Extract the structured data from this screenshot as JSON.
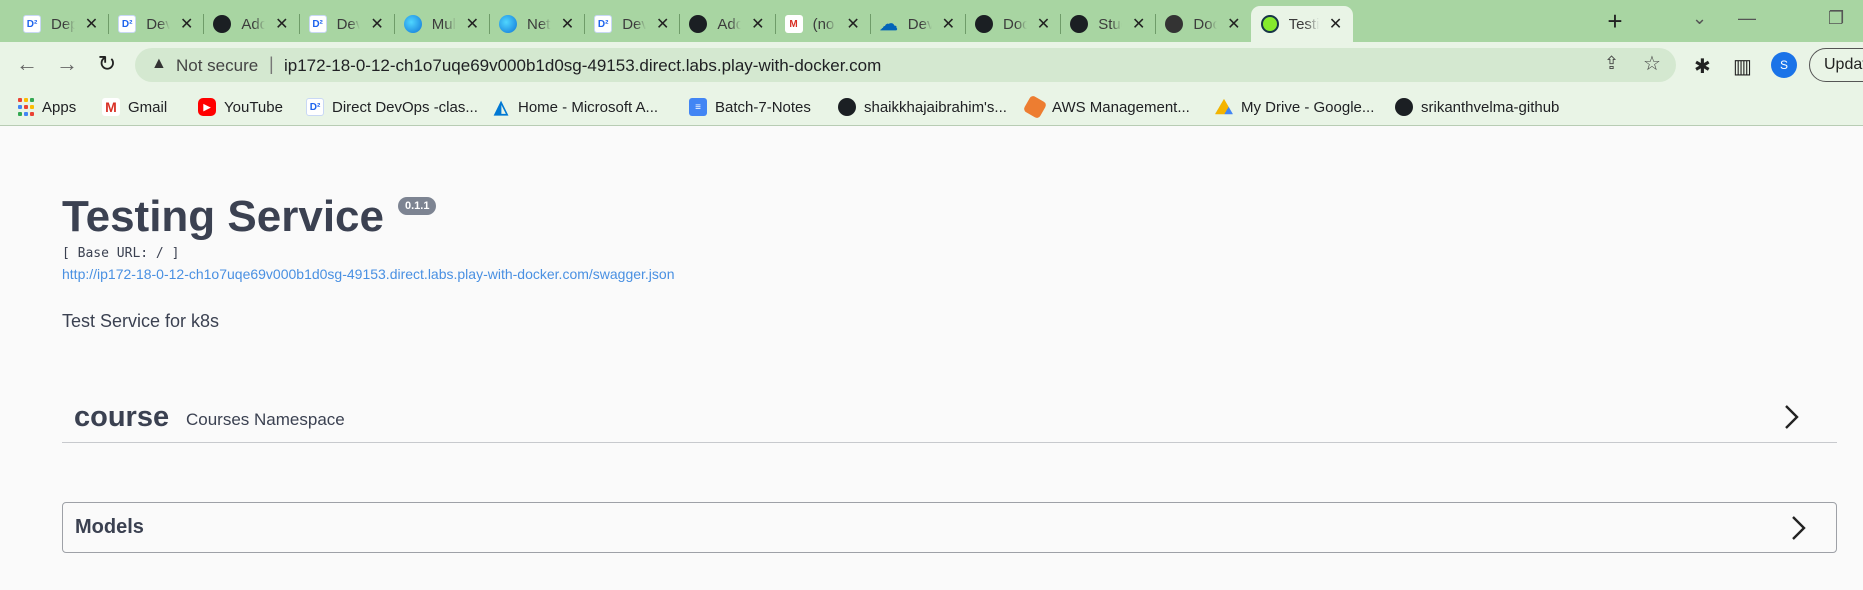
{
  "browser": {
    "tabs": [
      {
        "title": "Deploy",
        "icon": "docker-labs-icon",
        "favclass": "fav-docker",
        "glyph": "D²"
      },
      {
        "title": "DevOps",
        "icon": "docker-labs-icon",
        "favclass": "fav-docker",
        "glyph": "D²"
      },
      {
        "title": "Added",
        "icon": "github-icon",
        "favclass": "fav-gh",
        "glyph": ""
      },
      {
        "title": "DevOps",
        "icon": "docker-labs-icon",
        "favclass": "fav-docker",
        "glyph": "D²"
      },
      {
        "title": "Multi",
        "icon": "edge-icon",
        "favclass": "fav-edge",
        "glyph": ""
      },
      {
        "title": "Netw",
        "icon": "edge-icon",
        "favclass": "fav-edge",
        "glyph": ""
      },
      {
        "title": "DevOps",
        "icon": "docker-labs-icon",
        "favclass": "fav-docker",
        "glyph": "D²"
      },
      {
        "title": "Added",
        "icon": "github-icon",
        "favclass": "fav-gh",
        "glyph": ""
      },
      {
        "title": "(no s",
        "icon": "gmail-icon",
        "favclass": "fav-gmail",
        "glyph": "M"
      },
      {
        "title": "DevOps",
        "icon": "onedrive-icon",
        "favclass": "fav-onedrive",
        "glyph": "☁"
      },
      {
        "title": "Dock",
        "icon": "github-icon",
        "favclass": "fav-gh",
        "glyph": ""
      },
      {
        "title": "Stud",
        "icon": "github-icon",
        "favclass": "fav-gh",
        "glyph": ""
      },
      {
        "title": "Dock",
        "icon": "globe-icon",
        "favclass": "fav-globe",
        "glyph": ""
      },
      {
        "title": "Testi",
        "icon": "swagger-icon",
        "favclass": "fav-swagger",
        "glyph": "",
        "active": true
      }
    ],
    "new_tab_label": "+",
    "close_glyph": "✕",
    "omnibox": {
      "security_label": "Not secure",
      "separator": "|",
      "url": "ip172-18-0-12-ch1o7uqe69v000b1d0sg-49153.direct.labs.play-with-docker.com"
    },
    "profile_initial": "S",
    "update_label": "Update",
    "bookmarks": [
      {
        "label": "Apps",
        "icon": "apps-grid-icon",
        "iclass": "bmi-apps"
      },
      {
        "label": "Gmail",
        "icon": "gmail-icon",
        "iclass": "bmi-gmail"
      },
      {
        "label": "YouTube",
        "icon": "youtube-icon",
        "iclass": "bmi-yt"
      },
      {
        "label": "Direct DevOps -clas...",
        "icon": "docker-labs-icon",
        "iclass": "bmi-docker"
      },
      {
        "label": "Home - Microsoft A...",
        "icon": "azure-icon",
        "iclass": "bmi-azure"
      },
      {
        "label": "Batch-7-Notes",
        "icon": "google-docs-icon",
        "iclass": "bmi-docs"
      },
      {
        "label": "shaikkhajaibrahim's...",
        "icon": "github-icon",
        "iclass": "bmi-gh"
      },
      {
        "label": "AWS Management...",
        "icon": "aws-icon",
        "iclass": "bmi-aws"
      },
      {
        "label": "My Drive - Google...",
        "icon": "google-drive-icon",
        "iclass": "bmi-drive"
      },
      {
        "label": "srikanthvelma-github",
        "icon": "github-icon",
        "iclass": "bmi-gh"
      }
    ],
    "colors": {
      "chrome": "#a8d5a2",
      "toolbar": "#e9f4e6"
    }
  },
  "swagger": {
    "title": "Testing Service",
    "version": "0.1.1",
    "base_url": "[ Base URL: / ]",
    "spec_url": "http://ip172-18-0-12-ch1o7uqe69v000b1d0sg-49153.direct.labs.play-with-docker.com/swagger.json",
    "description": "Test Service for k8s",
    "namespaces": [
      {
        "name": "course",
        "description": "Courses Namespace"
      }
    ],
    "models_label": "Models",
    "colors": {
      "text": "#3b4151",
      "link": "#4990e2",
      "version_badge": "#7d8492"
    }
  }
}
